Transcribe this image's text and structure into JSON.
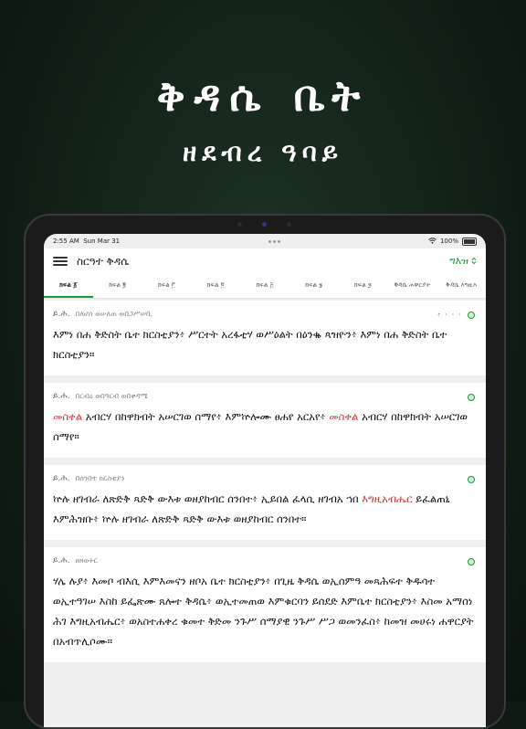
{
  "hero": {
    "title": "ቅዳሴ ቤት",
    "subtitle": "ዘደብረ ዓባይ"
  },
  "status_bar": {
    "time": "2:55 AM",
    "date": "Sun Mar 31",
    "battery": "100%"
  },
  "navbar": {
    "title": "ስርዓተ ቅዳሴ",
    "language": "ግእዝ"
  },
  "tabs": [
    "ክፍል ፩",
    "ክፍል ፪",
    "ክፍል ፫",
    "ክፍል ፬",
    "ክፍል ፭",
    "ክፍል ፮",
    "ክፍል ፯",
    "ቅዳሴ ሐዋርያት",
    "ቅዳሴ እግዚእ"
  ],
  "cards": [
    {
      "speaker": "ይ.ሕ.",
      "note": "በለሆሰ ወሠለጠ ወበጋሥሠቢ",
      "extra": "፥ ፡ ፡ ፡",
      "segments": [
        {
          "t": "እምነ በሐ ቅድስት ቤተ ክርስቲያን፥ ሥርተት አረፋቲሃ ወሥዕልት በዕንቈ ጳዝዮን፥ እምነ በሐ ቅድስት ቤተ ክርስቲያን።",
          "red": false
        }
      ]
    },
    {
      "speaker": "ይ.ሕ.",
      "note": "በርብዕ ወበዓርብ ወበቀዳሜ",
      "extra": "",
      "segments": [
        {
          "t": "መስቀል",
          "red": true
        },
        {
          "t": " አብርሃ በከዋክብት አሠርገወ ሰማየ፥ እምኵሎሙ ፀሐየ አርአየ፥ ",
          "red": false
        },
        {
          "t": "መስቀል",
          "red": true
        },
        {
          "t": " አብርሃ በከዋክብት አሠርገወ ሰማየ።",
          "red": false
        }
      ]
    },
    {
      "speaker": "ይ.ሕ.",
      "note": "በሰንበተ ክርስቲያን",
      "extra": "",
      "segments": [
        {
          "t": "ኵሉ ዘገብራ ለጽድቅ ጻድቅ ውእቱ ወዘያከብር ሰንበተ፥ ኢይበል ፈላሲ ዘገብአ ኀበ ",
          "red": false
        },
        {
          "t": "እግዚአብሔር",
          "red": true
        },
        {
          "t": " ይፈልጠኒ እምሕዝቡ፥ ኵሉ ዘገብራ ለጽድቅ ጻድቅ ውእቱ ወዘያከብር ሰንበተ።",
          "red": false
        }
      ]
    },
    {
      "speaker": "ይ.ሕ.",
      "note": "ዘዘወትር",
      "extra": "",
      "segments": [
        {
          "t": "ሃሌ ሉያ፥ እመቦ ብእሲ እምእመናን ዘቦአ ቤተ ክርስቲያን፥ በጊዜ ቅዳሴ ወኢሰምዓ መጻሕፍተ ቅዱሳተ ወኢተዓገሠ እስከ ይፌጽሙ ጸሎተ ቅዳሴ፥ ወኢተመጠወ እምቁርባን ይሰደድ እምቤተ ክርስቲያን፥ እስመ አማሰነ ሕገ እግዚአብሔር፥ ወአስተሐቀረ ቁመተ ቅድመ ንጉሥ ሰማያዊ ንጉሥ ሥጋ ወመንፈስ፥ ከመዝ መሀሩነ ሐዋርያት በአብጥሊሶሙ።",
          "red": false
        }
      ]
    }
  ]
}
